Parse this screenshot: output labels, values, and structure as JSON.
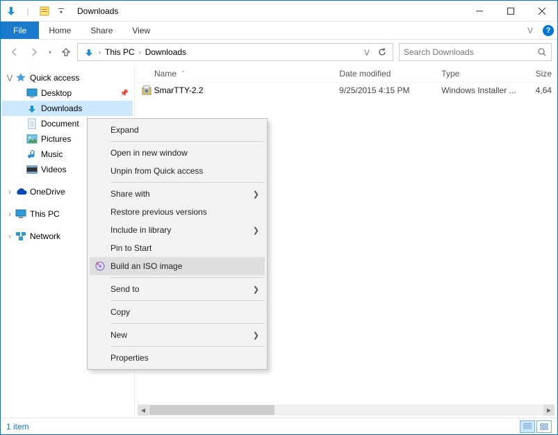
{
  "window": {
    "title": "Downloads"
  },
  "ribbon": {
    "file": "File",
    "tabs": [
      "Home",
      "Share",
      "View"
    ]
  },
  "breadcrumbs": [
    "This PC",
    "Downloads"
  ],
  "search": {
    "placeholder": "Search Downloads"
  },
  "tree": {
    "quick_access": {
      "label": "Quick access"
    },
    "items": [
      {
        "label": "Desktop",
        "pinned": true
      },
      {
        "label": "Downloads",
        "pinned": true,
        "selected": true
      },
      {
        "label": "Documents",
        "pinned": true
      },
      {
        "label": "Pictures",
        "pinned": true
      },
      {
        "label": "Music"
      },
      {
        "label": "Videos"
      }
    ],
    "onedrive": {
      "label": "OneDrive"
    },
    "thispc": {
      "label": "This PC"
    },
    "network": {
      "label": "Network"
    }
  },
  "columns": {
    "name": "Name",
    "date": "Date modified",
    "type": "Type",
    "size": "Size"
  },
  "rows": [
    {
      "name": "SmarTTY-2.2",
      "date": "9/25/2015 4:15 PM",
      "type": "Windows Installer ...",
      "size": "4,64"
    }
  ],
  "status": {
    "text": "1 item"
  },
  "context_menu": {
    "items": [
      {
        "label": "Expand"
      },
      {
        "sep": true
      },
      {
        "label": "Open in new window"
      },
      {
        "label": "Unpin from Quick access"
      },
      {
        "sep": true
      },
      {
        "label": "Share with",
        "submenu": true
      },
      {
        "label": "Restore previous versions"
      },
      {
        "label": "Include in library",
        "submenu": true
      },
      {
        "label": "Pin to Start"
      },
      {
        "label": "Build an ISO image",
        "icon": true,
        "hover": true
      },
      {
        "sep": true
      },
      {
        "label": "Send to",
        "submenu": true
      },
      {
        "sep": true
      },
      {
        "label": "Copy"
      },
      {
        "sep": true
      },
      {
        "label": "New",
        "submenu": true
      },
      {
        "sep": true
      },
      {
        "label": "Properties"
      }
    ]
  }
}
